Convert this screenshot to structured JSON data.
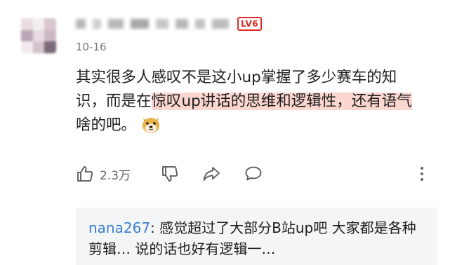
{
  "comment": {
    "user_level": "LV6",
    "date": "10-16",
    "text_part1": "其实很多人感叹不是这小up掌握了多少赛车的知识，而是在",
    "text_highlight": "惊叹up讲话的思维和逻辑性，还有语气",
    "text_part3": "啥的吧。",
    "emoji_icon": "doge-emoji-icon"
  },
  "actions": {
    "like_count": "2.3万",
    "icons": [
      "thumbs-up-icon",
      "thumbs-down-icon",
      "share-icon",
      "comment-icon",
      "more-icon"
    ]
  },
  "reply": {
    "user": "nana267",
    "text": ": 感觉超过了大部分B站up吧 大家都是各种剪辑… 说的话也好有逻辑一…"
  },
  "colors": {
    "highlight": "#fbd7d0",
    "level_badge": "#e02b22",
    "reply_user": "#3a7fd0",
    "reply_bg": "#f4f5f7"
  }
}
